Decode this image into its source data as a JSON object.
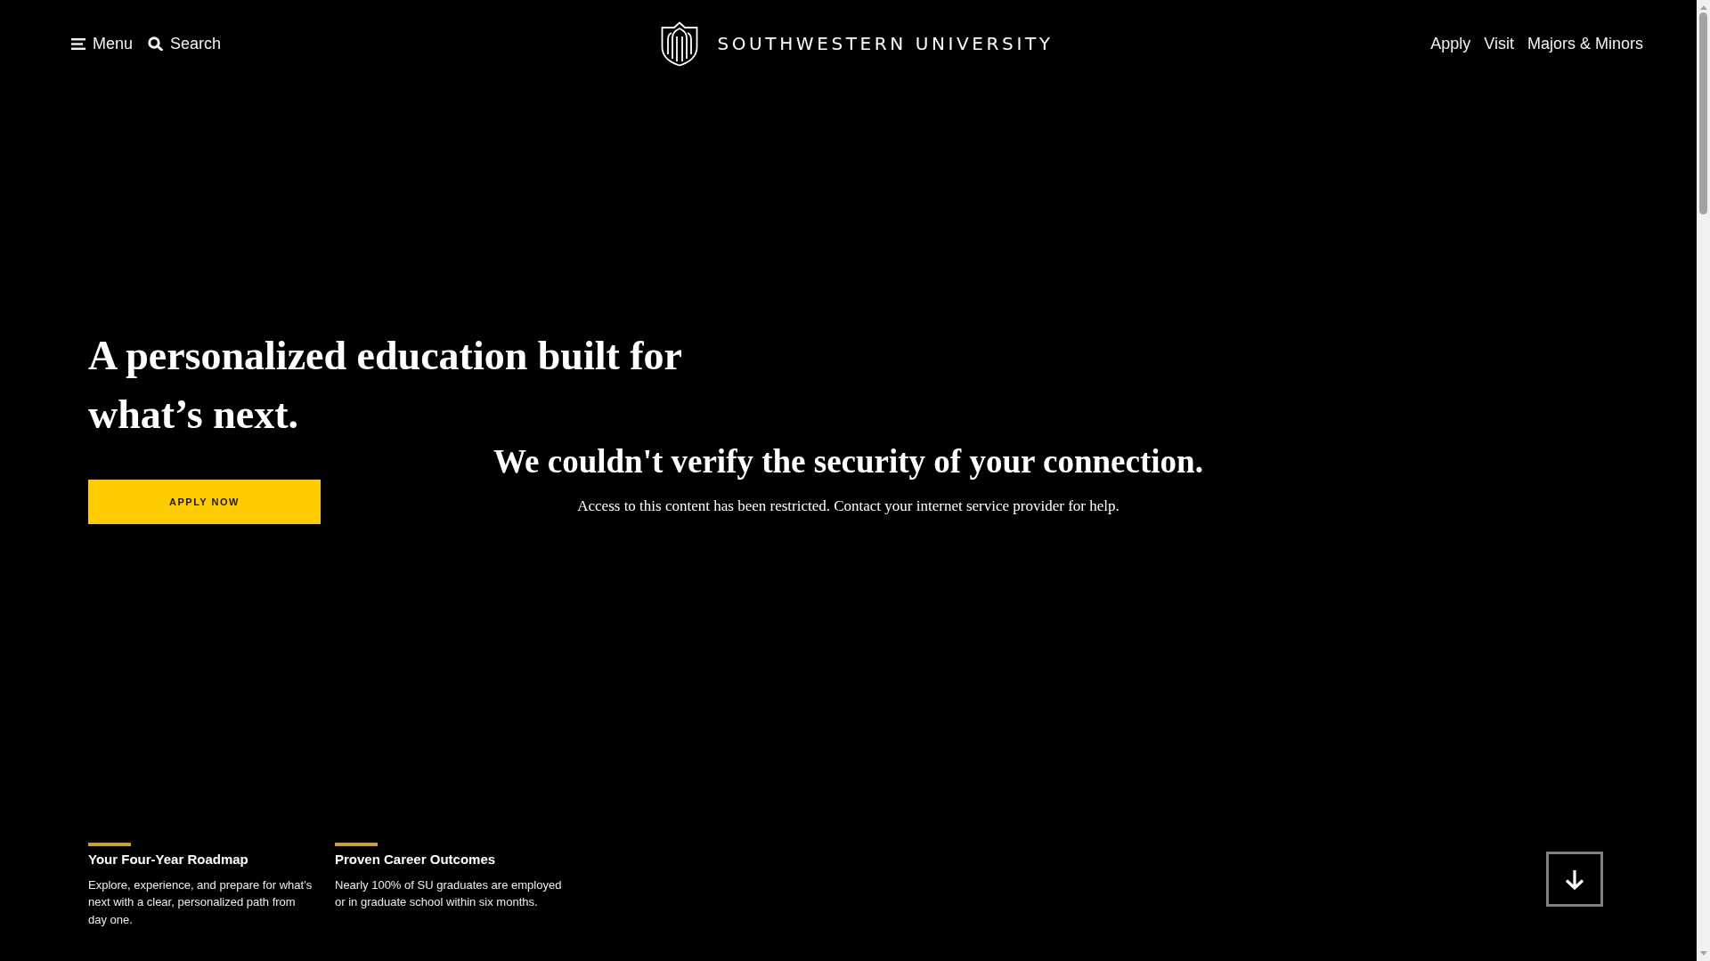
{
  "header": {
    "menu_button": {
      "label": "Menu"
    },
    "search_button": {
      "label": "Search"
    },
    "logo": {
      "wordmark": "SOUTHWESTERN UNIVERSITY"
    },
    "nav_links": [
      {
        "label": "Apply"
      },
      {
        "label": "Visit"
      },
      {
        "label": "Majors & Minors"
      }
    ]
  },
  "hero": {
    "headline": "A personalized education built for what’s next.",
    "apply_button": {
      "label": "APPLY NOW"
    },
    "features": [
      {
        "title": "Your Four-Year Roadmap",
        "text": "Explore, experience, and prepare for what’s next with a clear, personalized path from day one."
      },
      {
        "title": "Proven Career Outcomes",
        "text": "Nearly 100% of SU graduates are employed or in graduate school within six months."
      }
    ]
  },
  "security_notice": {
    "title": "We couldn't verify the security of your connection.",
    "message": "Access to this content has been restricted. Contact your internet service provider for help."
  }
}
